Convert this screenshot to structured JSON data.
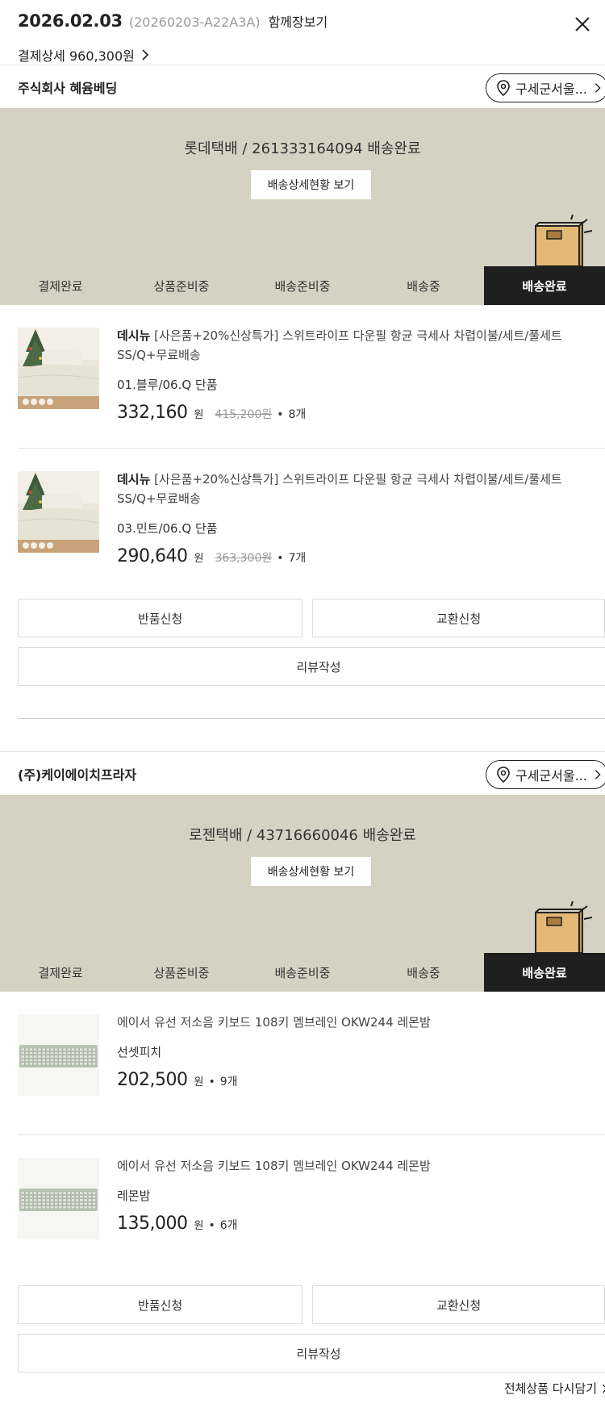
{
  "header": {
    "order_date": "2026.02.03",
    "order_number": "(20260203-A22A3A)",
    "cart_link": "함께장보기",
    "payment_detail": "결제상세 960,300원"
  },
  "sections": [
    {
      "seller": "주식회사 혜윰베딩",
      "location": "구세군서울...",
      "delivery_status": "롯데택배 / 261333164094 배송완료",
      "track_button": "배송상세현황 보기",
      "steps": [
        "결제완료",
        "상품준비중",
        "배송준비중",
        "배송중",
        "배송완료"
      ],
      "active_step": "배송완료",
      "items": [
        {
          "brand": "데시뉴",
          "name": " [사은품+20%신상특가] 스위트라이프 다운필 항균 극세사 차렵이불/세트/풀세트 SS/Q+무료배송",
          "option": "01.블루/06.Q 단품",
          "price": "332,160",
          "won": "원",
          "original_price": "415,200원",
          "dot": "•",
          "qty": "8개"
        },
        {
          "brand": "데시뉴",
          "name": " [사은품+20%신상특가] 스위트라이프 다운필 항균 극세사 차렵이불/세트/풀세트 SS/Q+무료배송",
          "option": "03.민트/06.Q 단품",
          "price": "290,640",
          "won": "원",
          "original_price": "363,300원",
          "dot": "•",
          "qty": "7개"
        }
      ],
      "actions": {
        "return": "반품신청",
        "exchange": "교환신청",
        "review": "리뷰작성"
      }
    },
    {
      "seller": "(주)케이에이치프라자",
      "location": "구세군서울...",
      "delivery_status": "로젠택배 / 43716660046 배송완료",
      "track_button": "배송상세현황 보기",
      "steps": [
        "결제완료",
        "상품준비중",
        "배송준비중",
        "배송중",
        "배송완료"
      ],
      "active_step": "배송완료",
      "items": [
        {
          "brand": "",
          "name": "에이서 유선 저소음 키보드 108키 멤브레인 OKW244 레몬밤",
          "option": "선셋피치",
          "price": "202,500",
          "won": "원",
          "original_price": "",
          "dot": "•",
          "qty": "9개"
        },
        {
          "brand": "",
          "name": "에이서 유선 저소음 키보드 108키 멤브레인 OKW244 레몬밤",
          "option": "레몬밤",
          "price": "135,000",
          "won": "원",
          "original_price": "",
          "dot": "•",
          "qty": "6개"
        }
      ],
      "actions": {
        "return": "반품신청",
        "exchange": "교환신청",
        "review": "리뷰작성"
      }
    }
  ],
  "footer": {
    "redo_all": "전체상품 다시담기"
  },
  "colors": {
    "banner_bg": "#d5d2c3",
    "active_step_bg": "#1f1f1f",
    "box": "#e2b874"
  },
  "icons": [
    "close-icon",
    "chevron-right-icon",
    "location-pin-icon",
    "delivery-box-icon"
  ]
}
